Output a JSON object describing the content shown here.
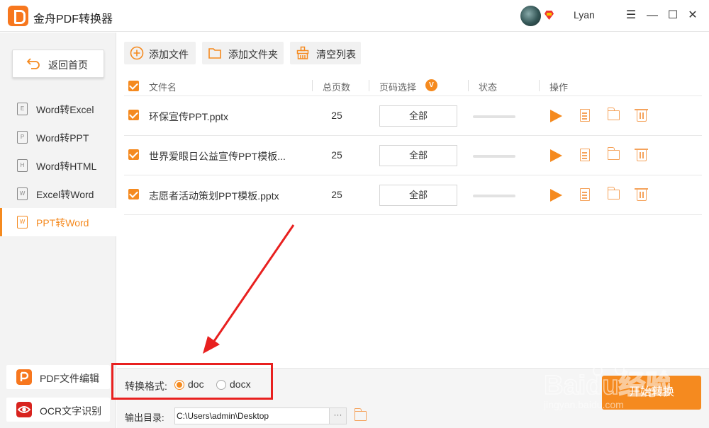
{
  "app": {
    "title": "金舟PDF转换器"
  },
  "user": {
    "name": "Lyan"
  },
  "window_controls": {
    "menu": "☰",
    "minimize": "—",
    "maximize": "☐",
    "close": "✕"
  },
  "sidebar": {
    "home_label": "返回首页",
    "items": [
      {
        "label": "Word转Excel",
        "icon": "E"
      },
      {
        "label": "Word转PPT",
        "icon": "P"
      },
      {
        "label": "Word转HTML",
        "icon": "H"
      },
      {
        "label": "Excel转Word",
        "icon": "W"
      },
      {
        "label": "PPT转Word",
        "icon": "W"
      }
    ],
    "active_index": 4,
    "tools": [
      {
        "label": "PDF文件编辑"
      },
      {
        "label": "OCR文字识别"
      }
    ]
  },
  "toolbar": {
    "add_file": "添加文件",
    "add_folder": "添加文件夹",
    "clear_list": "清空列表"
  },
  "table": {
    "headers": {
      "name": "文件名",
      "pages": "总页数",
      "range": "页码选择",
      "range_badge": "V",
      "status": "状态",
      "actions": "操作"
    },
    "rows": [
      {
        "name": "环保宣传PPT.pptx",
        "pages": "25",
        "range": "全部",
        "checked": true,
        "progress": 0
      },
      {
        "name": "世界爱眼日公益宣传PPT模板...",
        "pages": "25",
        "range": "全部",
        "checked": true,
        "progress": 0
      },
      {
        "name": "志愿者活动策划PPT模板.pptx",
        "pages": "25",
        "range": "全部",
        "checked": true,
        "progress": 0
      }
    ]
  },
  "output": {
    "format_label": "转换格式:",
    "formats": [
      {
        "label": "doc",
        "selected": true
      },
      {
        "label": "docx",
        "selected": false
      }
    ],
    "dir_label": "输出目录:",
    "dir_path": "C:\\Users\\admin\\Desktop",
    "browse_label": "···"
  },
  "start_button": "开始转换",
  "watermark": {
    "brand": "Baidu经验",
    "url": "jingyan.baidu.com"
  },
  "colors": {
    "accent": "#f58a1f",
    "annotation": "#e8201f"
  }
}
